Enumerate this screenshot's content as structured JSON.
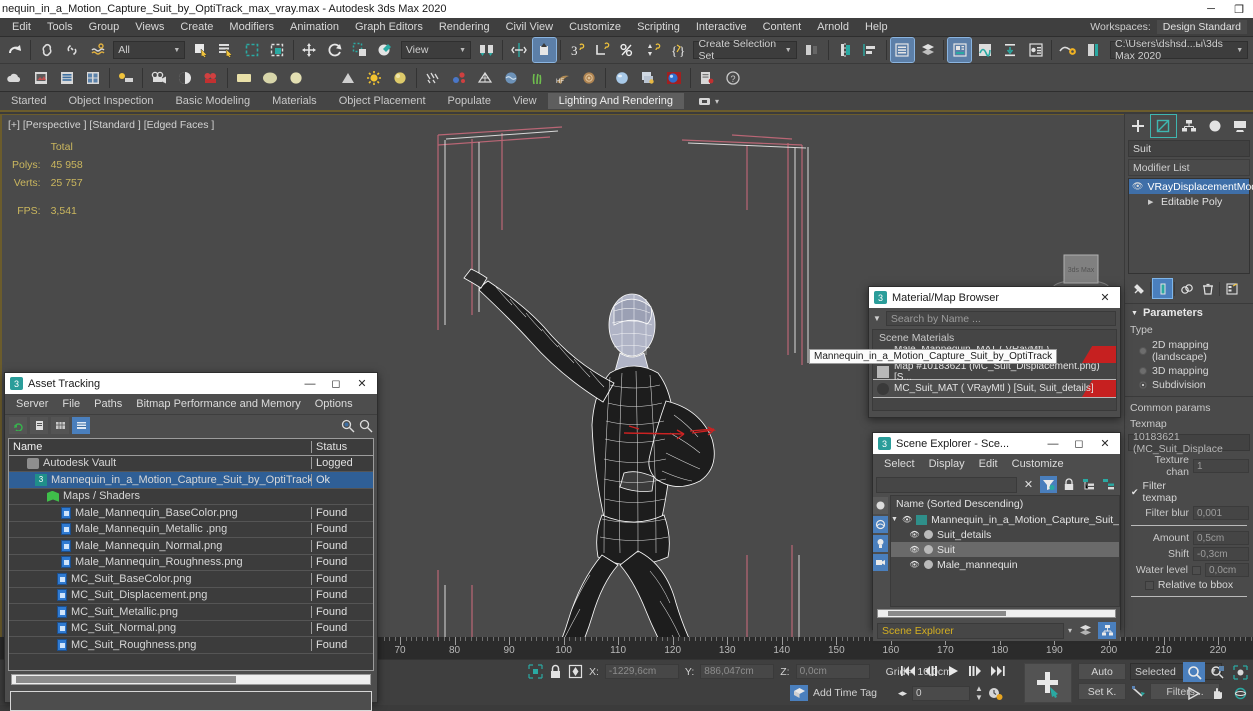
{
  "titlebar": {
    "title": "nequin_in_a_Motion_Capture_Suit_by_OptiTrack_max_vray.max - Autodesk 3ds Max 2020",
    "minimize": "─",
    "maximize": "❐",
    "close": ""
  },
  "menubar": {
    "items": [
      "Edit",
      "Tools",
      "Group",
      "Views",
      "Create",
      "Modifiers",
      "Animation",
      "Graph Editors",
      "Rendering",
      "Civil View",
      "Customize",
      "Scripting",
      "Interactive",
      "Content",
      "Arnold",
      "Help"
    ],
    "workspaces_label": "Workspaces:",
    "workspaces_value": "Design Standard"
  },
  "toolbar1": {
    "selection_filter": "All",
    "reference_coord": "View",
    "named_selection_set": "Create Selection Set",
    "project_folder": "C:\\Users\\dshsd...ы\\3ds Max 2020"
  },
  "tabstrip": {
    "tabs": [
      {
        "label": "Started",
        "active": false
      },
      {
        "label": "Object Inspection",
        "active": false
      },
      {
        "label": "Basic Modeling",
        "active": false
      },
      {
        "label": "Materials",
        "active": false
      },
      {
        "label": "Object Placement",
        "active": false
      },
      {
        "label": "Populate",
        "active": false
      },
      {
        "label": "View",
        "active": false
      },
      {
        "label": "Lighting And Rendering",
        "active": true
      }
    ]
  },
  "viewport": {
    "label": "[+] [Perspective ] [Standard ] [Edged Faces ]",
    "stats": {
      "header": "Total",
      "polys_label": "Polys:",
      "polys_value": "45 958",
      "verts_label": "Verts:",
      "verts_value": "25 757",
      "fps_label": "FPS:",
      "fps_value": "3,541"
    }
  },
  "command_panel": {
    "tabs": [
      "create-tab",
      "modify-tab",
      "hierarchy-tab",
      "motion-tab",
      "display-tab"
    ],
    "selected_tab_index": 1,
    "object_name": "Suit",
    "modifier_list_label": "Modifier List",
    "modifiers": [
      {
        "name": "VRayDisplacementMod",
        "selected": true,
        "eye": true
      },
      {
        "name": "Editable Poly",
        "selected": false,
        "eye": false
      }
    ],
    "parameters_rollout": "Parameters",
    "type_label": "Type",
    "type_options": [
      {
        "label": "2D mapping (landscape)",
        "selected": false
      },
      {
        "label": "3D mapping",
        "selected": false
      },
      {
        "label": "Subdivision",
        "selected": true
      }
    ],
    "common_params_label": "Common params",
    "texmap_label": "Texmap",
    "texmap_value": "10183621 (MC_Suit_Displace",
    "fields": [
      {
        "label": "Texture chan",
        "value": "1"
      },
      {
        "label": "Filter blur",
        "value": "0,001"
      },
      {
        "label": "Amount",
        "value": "0,5cm"
      },
      {
        "label": "Shift",
        "value": "-0,3cm"
      },
      {
        "label": "Water level",
        "value": "0,0cm"
      }
    ],
    "filter_texmap_label": "Filter texmap",
    "filter_texmap_checked": true,
    "relative_to_bbox_label": "Relative to bbox",
    "relative_to_bbox_checked": false
  },
  "timeline": {
    "labels": [
      70,
      80,
      90,
      100,
      110,
      120,
      130,
      140,
      150,
      160,
      170,
      180,
      190,
      200,
      210,
      220
    ]
  },
  "statusbar": {
    "x_label": "X:",
    "x_value": "-1229,6cm",
    "y_label": "Y:",
    "y_value": "886,047cm",
    "z_label": "Z:",
    "z_value": "0,0cm",
    "grid_text": "Grid = 10,0cm",
    "add_time_tag": "Add Time Tag",
    "frame_value": "0",
    "auto_key": "Auto",
    "set_key": "Set K.",
    "key_filters_dropdown": "Selected",
    "filters_button": "Filters..."
  },
  "asset_tracking": {
    "title": "Asset Tracking",
    "menu": [
      "Server",
      "File",
      "Paths",
      "Bitmap Performance and Memory",
      "Options"
    ],
    "columns": [
      "Name",
      "Status"
    ],
    "rows": [
      {
        "name": "Autodesk Vault",
        "status": "Logged",
        "indent": 0,
        "icon": "vault-icon",
        "selected": false
      },
      {
        "name": "Mannequin_in_a_Motion_Capture_Suit_by_OptiTrack_max_vr...",
        "status": "Ok",
        "indent": 1,
        "icon": "max-file-icon",
        "selected": true
      },
      {
        "name": "Maps / Shaders",
        "status": "",
        "indent": 2,
        "icon": "maps-icon",
        "selected": false
      },
      {
        "name": "Male_Mannequin_BaseColor.png",
        "status": "Found",
        "indent": 3,
        "icon": "bitmap-icon",
        "selected": false
      },
      {
        "name": "Male_Mannequin_Metallic .png",
        "status": "Found",
        "indent": 3,
        "icon": "bitmap-icon",
        "selected": false
      },
      {
        "name": "Male_Mannequin_Normal.png",
        "status": "Found",
        "indent": 3,
        "icon": "bitmap-icon",
        "selected": false
      },
      {
        "name": "Male_Mannequin_Roughness.png",
        "status": "Found",
        "indent": 3,
        "icon": "bitmap-icon",
        "selected": false
      },
      {
        "name": "MC_Suit_BaseColor.png",
        "status": "Found",
        "indent": 3,
        "icon": "bitmap-icon",
        "selected": false
      },
      {
        "name": "MC_Suit_Displacement.png",
        "status": "Found",
        "indent": 3,
        "icon": "bitmap-icon",
        "selected": false
      },
      {
        "name": "MC_Suit_Metallic.png",
        "status": "Found",
        "indent": 3,
        "icon": "bitmap-icon",
        "selected": false
      },
      {
        "name": "MC_Suit_Normal.png",
        "status": "Found",
        "indent": 3,
        "icon": "bitmap-icon",
        "selected": false
      },
      {
        "name": "MC_Suit_Roughness.png",
        "status": "Found",
        "indent": 3,
        "icon": "bitmap-icon",
        "selected": false
      }
    ]
  },
  "material_browser": {
    "title": "Material/Map Browser",
    "search_placeholder": "Search by Name ...",
    "group_label": "Scene Materials",
    "tooltip": "Mannequin_in_a_Motion_Capture_Suit_by_OptiTrack",
    "rows": [
      {
        "label": "Male_Mannequin_MAT  ( VRayMtl )  [Male_manne...",
        "selected": false,
        "swatch": "#7c7c86"
      },
      {
        "label": "Map #10183621 (MC_Suit_Displacement.png)   [S...",
        "selected": false,
        "swatch": "#b8b8b8"
      },
      {
        "label": "MC_Suit_MAT  ( VRayMtl )  [Suit, Suit_details]",
        "selected": true,
        "swatch": "#3a3a3a"
      }
    ]
  },
  "scene_explorer": {
    "title": "Scene Explorer - Sce...",
    "menu": [
      "Select",
      "Display",
      "Edit",
      "Customize"
    ],
    "column_header": "Name (Sorted Descending)",
    "rows": [
      {
        "name": "Mannequin_in_a_Motion_Capture_Suit_by_Opti",
        "indent": 0,
        "group": true,
        "selected": false
      },
      {
        "name": "Suit_details",
        "indent": 1,
        "group": false,
        "selected": false
      },
      {
        "name": "Suit",
        "indent": 1,
        "group": false,
        "selected": true
      },
      {
        "name": "Male_mannequin",
        "indent": 1,
        "group": false,
        "selected": false
      }
    ],
    "footer_label": "Scene Explorer"
  }
}
